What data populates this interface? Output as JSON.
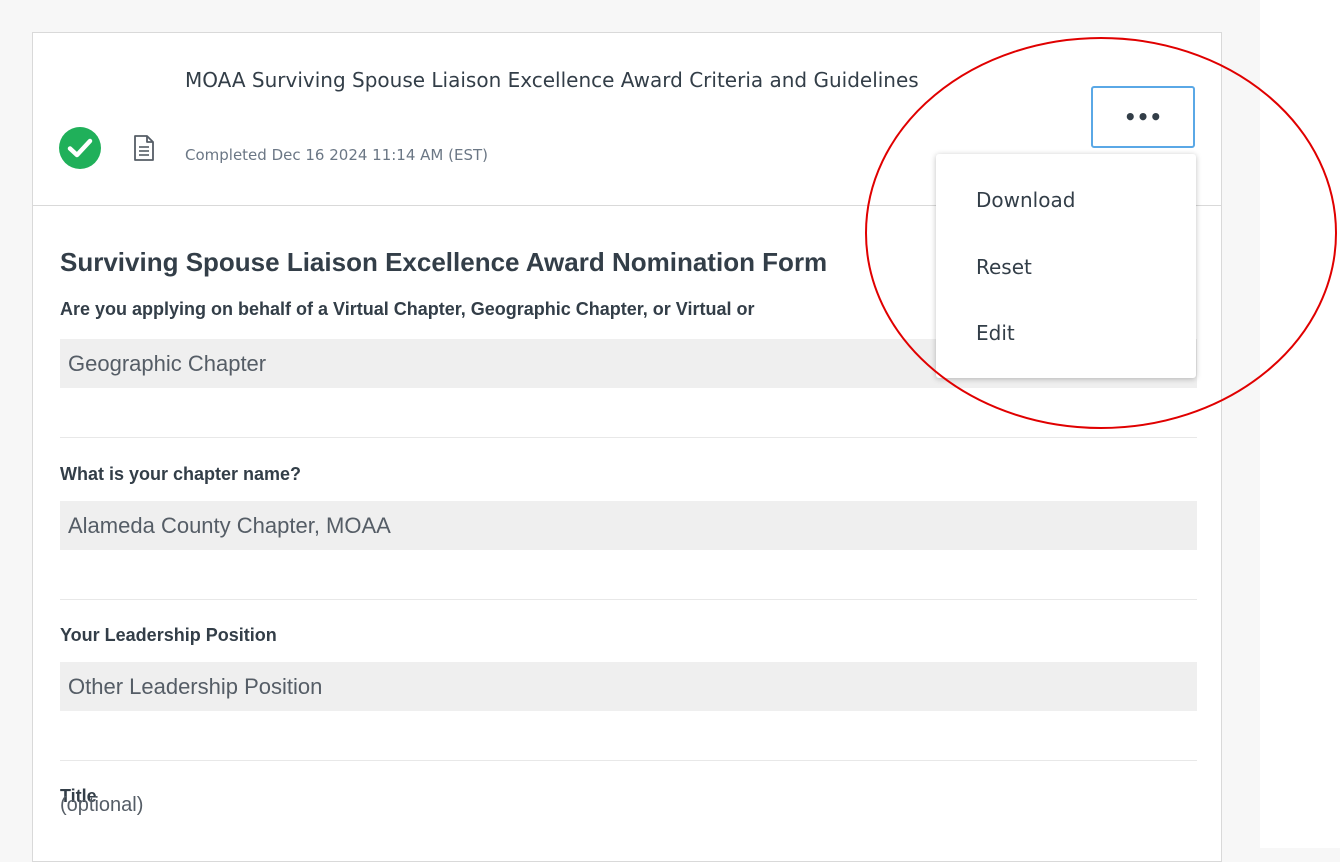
{
  "header": {
    "title": "MOAA Surviving Spouse Liaison Excellence Award Criteria and Guidelines",
    "completed": "Completed Dec 16 2024 11:14 AM (EST)",
    "more_button_label": "•••",
    "status_icon": "check-circle-icon",
    "doc_icon": "document-icon"
  },
  "menu": {
    "items": [
      {
        "label": "Download"
      },
      {
        "label": "Reset"
      },
      {
        "label": "Edit"
      }
    ]
  },
  "form": {
    "title": "Surviving Spouse Liaison Excellence Award Nomination Form",
    "questions": [
      {
        "label": "Are you applying on behalf of a Virtual Chapter, Geographic Chapter, or Virtual or",
        "answer": "Geographic Chapter"
      },
      {
        "label": "What is your chapter name?",
        "answer": "Alameda County Chapter, MOAA"
      },
      {
        "label": "Your Leadership Position",
        "answer": "Other Leadership Position"
      },
      {
        "label": "Title",
        "hint": "(optional)"
      }
    ]
  },
  "colors": {
    "success": "#20b05a",
    "button_border": "#5aa8e6",
    "annotation": "#e00000",
    "answer_bg": "#efefef"
  }
}
